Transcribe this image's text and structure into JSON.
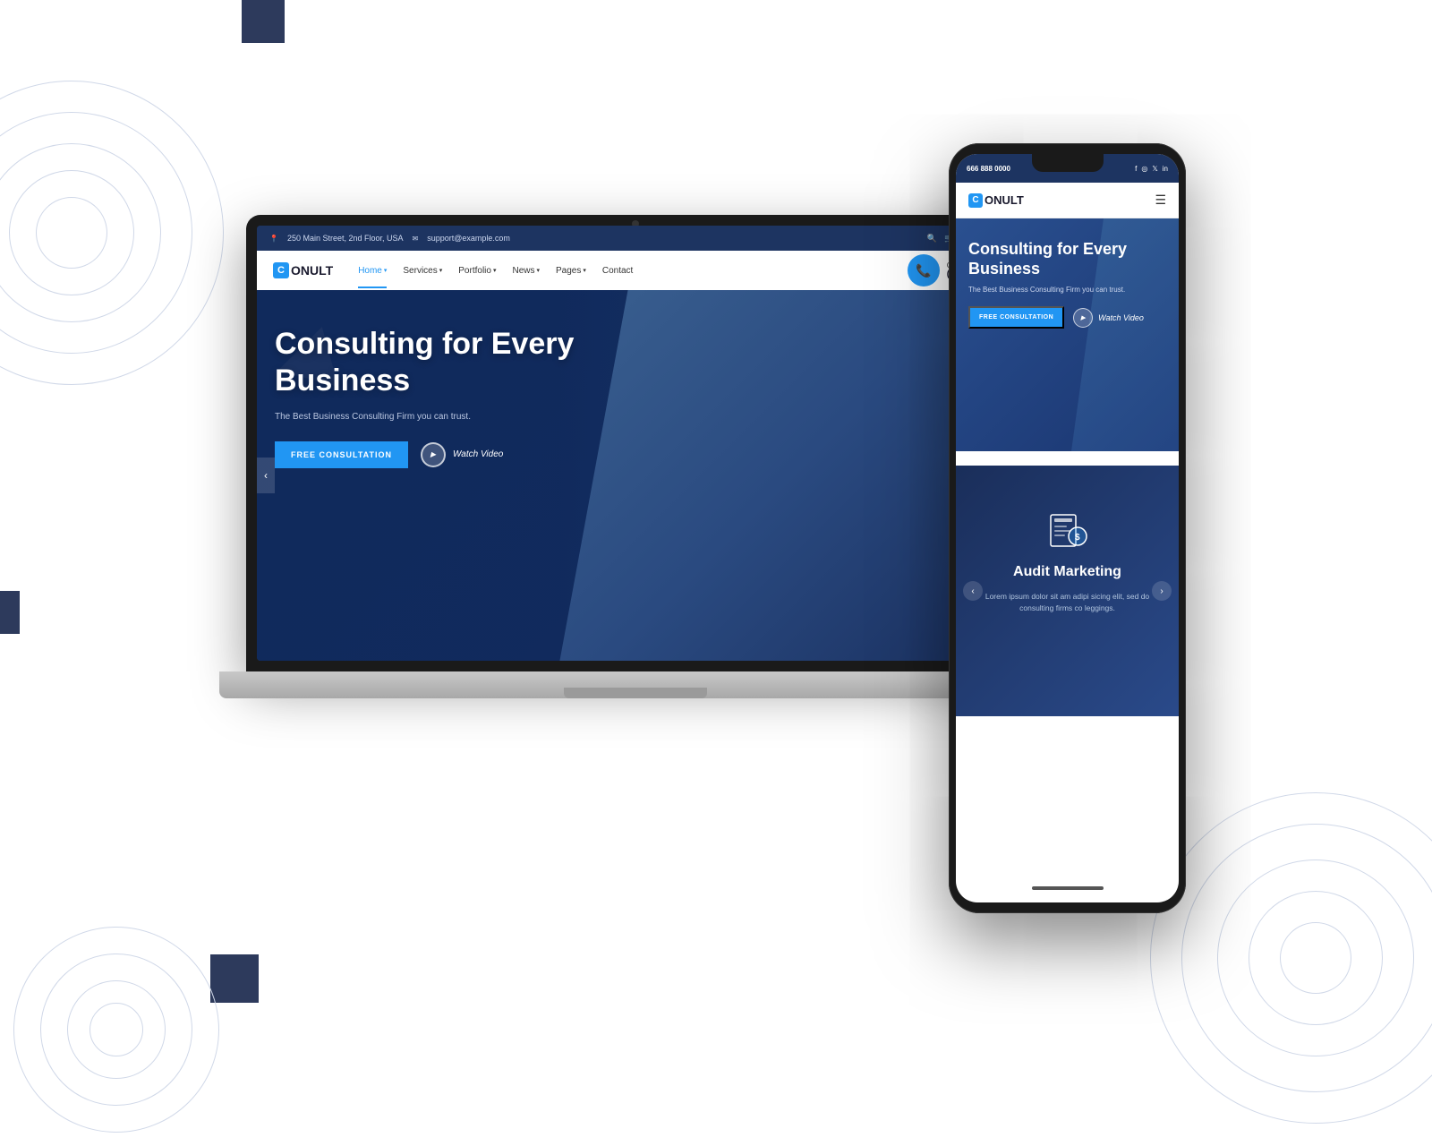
{
  "page": {
    "bg_color": "#ffffff"
  },
  "laptop": {
    "topbar": {
      "address": "250 Main Street, 2nd Floor, USA",
      "email": "support@example.com",
      "cart_badge": "0"
    },
    "navbar": {
      "logo": "ONULT",
      "logo_c": "C",
      "nav_items": [
        {
          "label": "Home",
          "arrow": "▾",
          "active": true
        },
        {
          "label": "Services",
          "arrow": "▾",
          "active": false
        },
        {
          "label": "Portfolio",
          "arrow": "▾",
          "active": false
        },
        {
          "label": "News",
          "arrow": "▾",
          "active": false
        },
        {
          "label": "Pages",
          "arrow": "▾",
          "active": false
        },
        {
          "label": "Contact",
          "arrow": "",
          "active": false
        }
      ],
      "call_anytime": "Call Anytime",
      "phone": "(38) 776-000"
    },
    "hero": {
      "title": "Consulting for Every Business",
      "subtitle": "The Best Business Consulting Firm you can trust.",
      "btn_primary": "FREE CONSULTATION",
      "btn_video": "Watch Video"
    }
  },
  "smartphone": {
    "statusbar": {
      "phone": "666 888 0000"
    },
    "navbar": {
      "logo": "ONULT",
      "logo_c": "C"
    },
    "hero": {
      "title": "Consulting for Every Business",
      "subtitle": "The Best Business Consulting Firm you can trust.",
      "btn_primary": "FREE CONSULTATION",
      "btn_video": "Watch Video"
    },
    "service": {
      "title": "Audit Marketing",
      "text": "Lorem ipsum dolor sit am adipi sicing elit, sed do consulting firms co leggings."
    }
  }
}
